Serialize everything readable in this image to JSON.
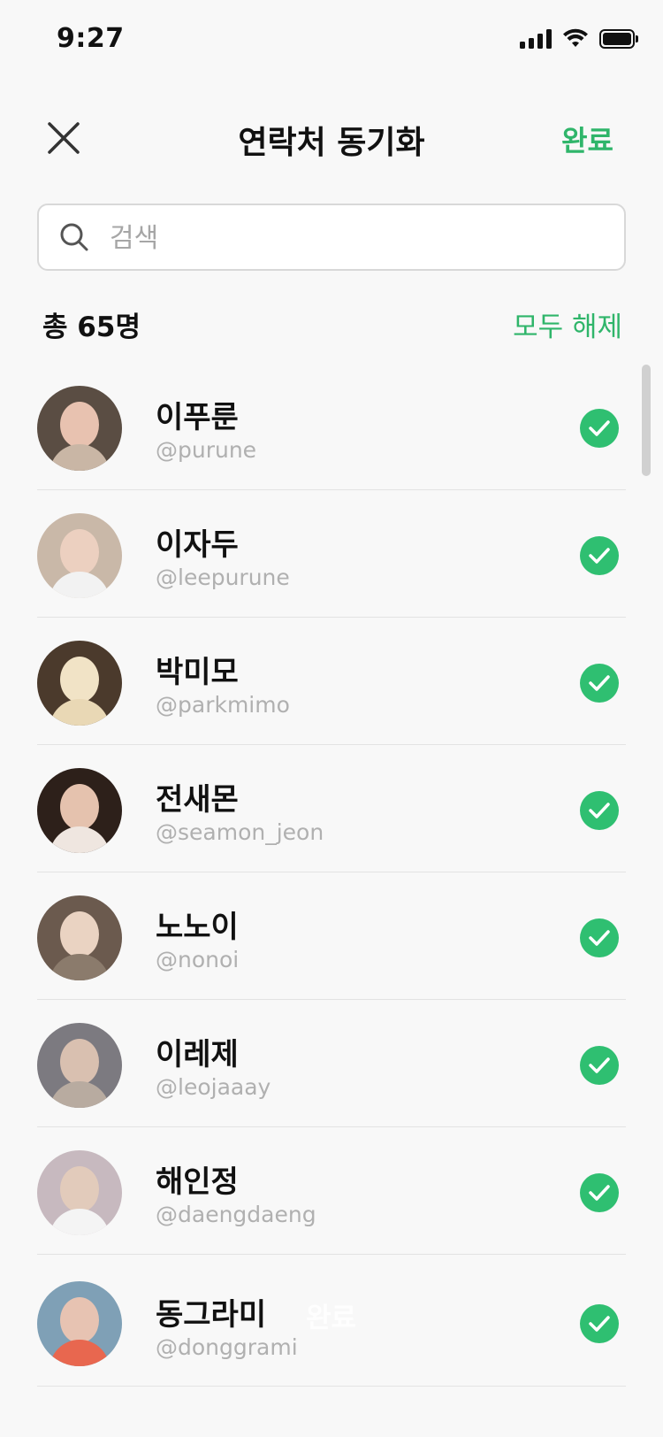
{
  "status_bar": {
    "time": "9:27"
  },
  "header": {
    "title": "연락처 동기화",
    "done_label": "완료",
    "close_icon": "close-icon"
  },
  "search": {
    "placeholder": "검색",
    "value": ""
  },
  "summary": {
    "total": "총 65명",
    "deselect_all": "모두 해제"
  },
  "contacts": [
    {
      "name": "이푸룬",
      "handle": "@purune",
      "checked": true,
      "avatar_bg": "#5a4d43",
      "face": "#e8c2b0",
      "body": "#c9b6a5"
    },
    {
      "name": "이자두",
      "handle": "@leepurune",
      "checked": true,
      "avatar_bg": "#c9b8a8",
      "face": "#ecd0c0",
      "body": "#f2f2f2"
    },
    {
      "name": "박미모",
      "handle": "@parkmimo",
      "checked": true,
      "avatar_bg": "#4b3a2c",
      "face": "#f1e3c6",
      "body": "#e9d8b5"
    },
    {
      "name": "전새몬",
      "handle": "@seamon_jeon",
      "checked": true,
      "avatar_bg": "#2d201a",
      "face": "#e5c2ae",
      "body": "#efe6e0"
    },
    {
      "name": "노노이",
      "handle": "@nonoi",
      "checked": true,
      "avatar_bg": "#6b5a4e",
      "face": "#ead3c2",
      "body": "#8b7b6c"
    },
    {
      "name": "이레제",
      "handle": "@leojaaay",
      "checked": true,
      "avatar_bg": "#7c7a80",
      "face": "#d9c0b0",
      "body": "#b8aba0"
    },
    {
      "name": "해인정",
      "handle": "@daengdaeng",
      "checked": true,
      "avatar_bg": "#c7b9bf",
      "face": "#e2cbbb",
      "body": "#f4f4f4"
    },
    {
      "name": "동그라미",
      "handle": "@donggrami",
      "checked": true,
      "avatar_bg": "#7fa0b6",
      "face": "#e7c3b2",
      "body": "#e8674f"
    }
  ],
  "floating_overlay": "완료",
  "colors": {
    "accent": "#2fb56a",
    "check": "#2fbf71",
    "muted": "#b0b0b0"
  }
}
